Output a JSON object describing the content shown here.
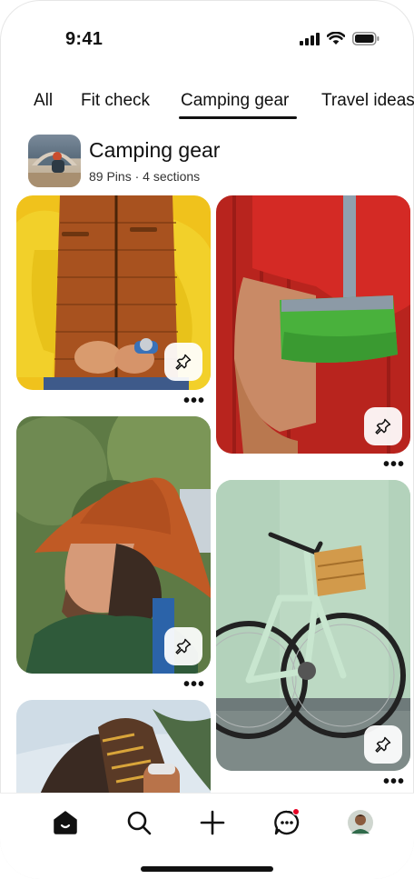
{
  "status_bar": {
    "time": "9:41"
  },
  "tabs": [
    {
      "label": "All"
    },
    {
      "label": "Fit check"
    },
    {
      "label": "Camping gear"
    },
    {
      "label": "Travel ideas"
    }
  ],
  "board": {
    "title": "Camping gear",
    "meta": "89 Pins · 4 sections"
  },
  "pins": [
    {
      "description": "puffer-vest",
      "more": "•••"
    },
    {
      "description": "green-lunch-bag",
      "more": "•••"
    },
    {
      "description": "orange-hat",
      "more": "•••"
    },
    {
      "description": "mint-bicycle",
      "more": "•••"
    },
    {
      "description": "hiking-boots"
    }
  ],
  "nav": {
    "home": "home-icon",
    "search": "search-icon",
    "create": "plus-icon",
    "messages": "messages-icon",
    "profile": "avatar"
  },
  "colors": {
    "accent": "#111111",
    "notification": "#e60023"
  }
}
